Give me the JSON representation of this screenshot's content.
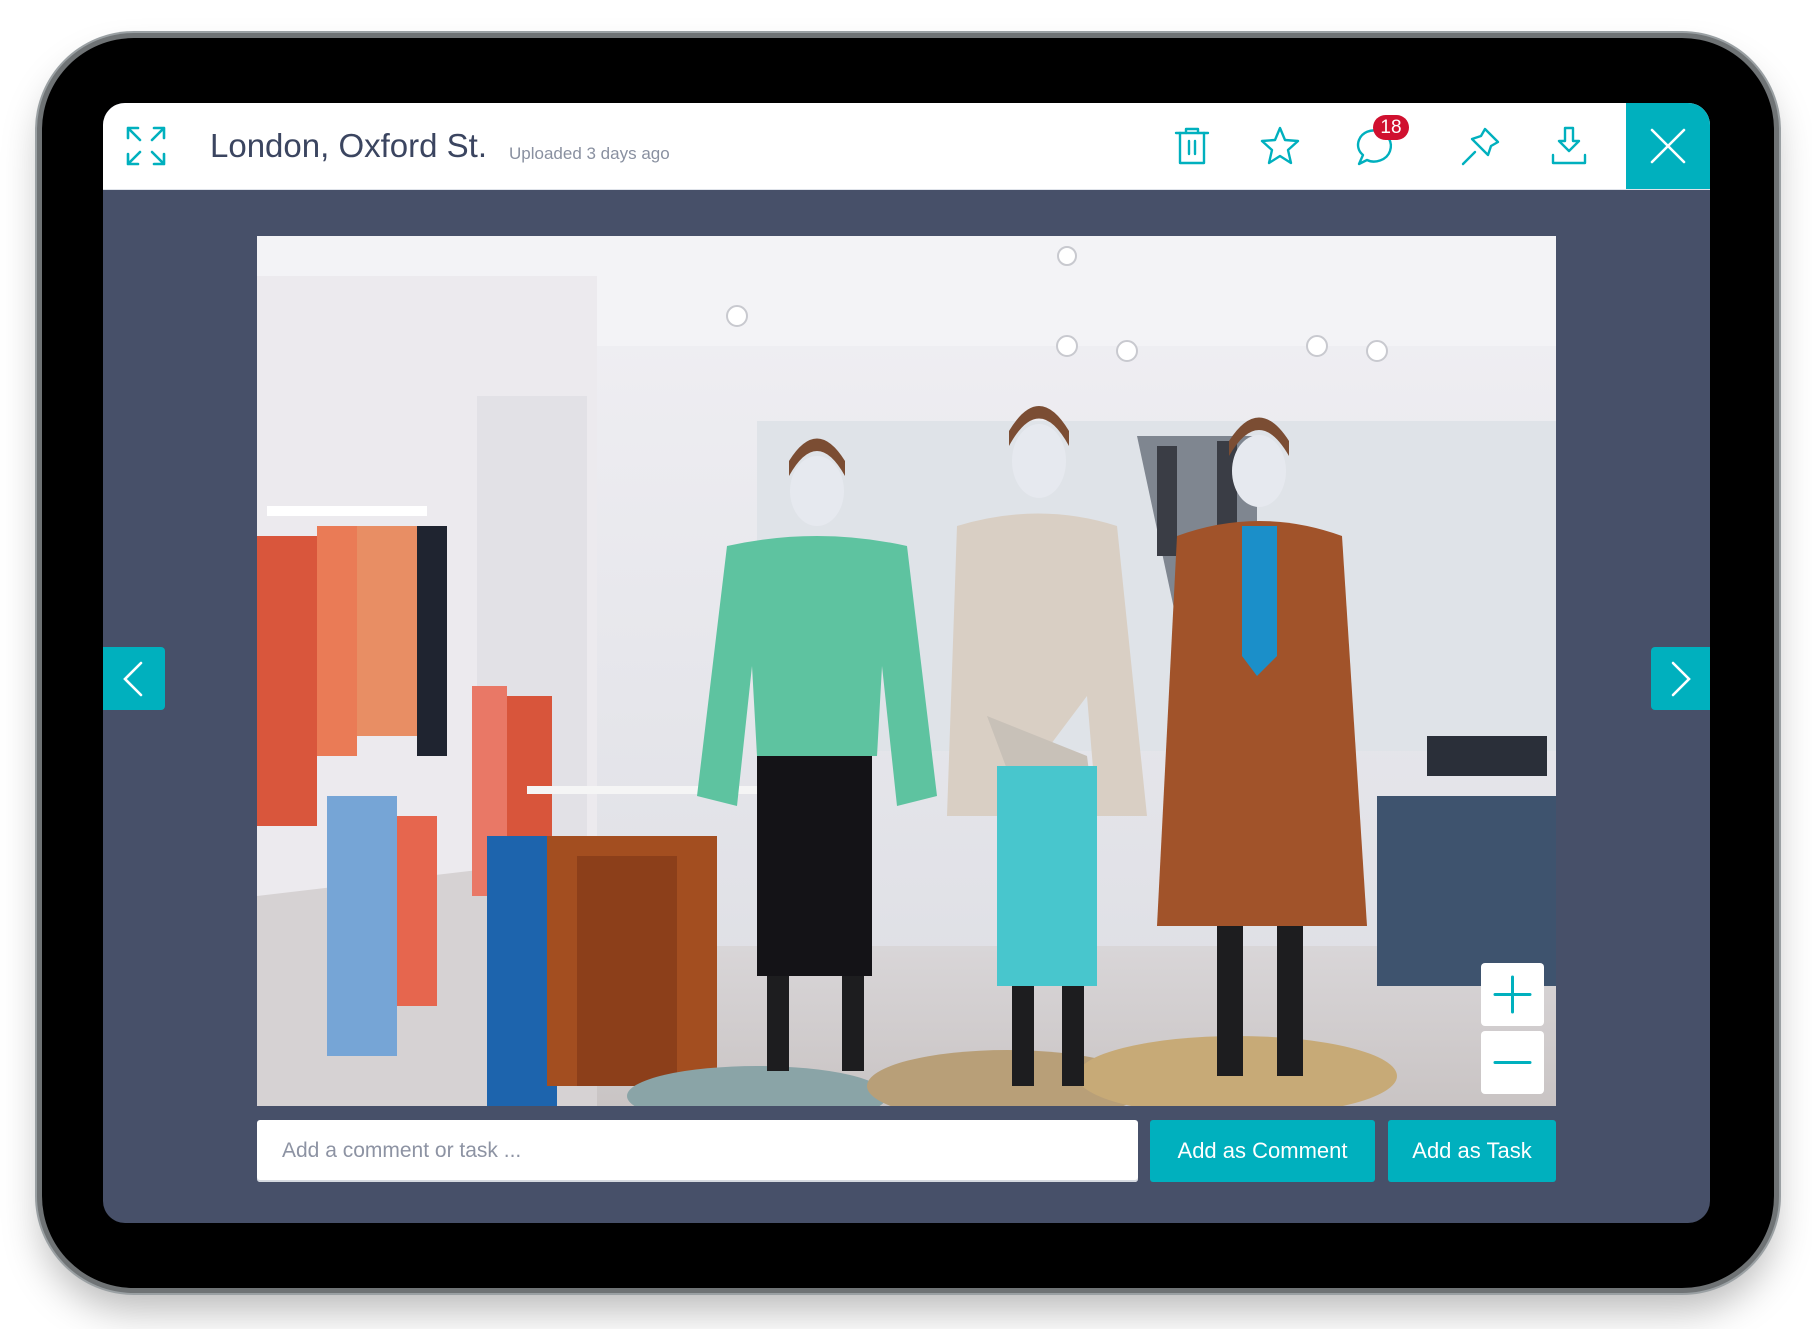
{
  "header": {
    "title": "London, Oxford St.",
    "subtitle": "Uploaded 3  days ago",
    "comment_count": "18",
    "icons": [
      "expand-icon",
      "trash-icon",
      "star-icon",
      "comment-icon",
      "pin-icon",
      "download-icon",
      "close-icon"
    ]
  },
  "navigation": {
    "prev_icon": "chevron-left-icon",
    "next_icon": "chevron-right-icon"
  },
  "photo": {
    "alt": "Three mannequins in a clothing store: green sweater with black trousers, beige corduroy jacket with teal skirt, and brown long coat; clothing racks and escalator in background"
  },
  "zoom_controls": {
    "zoom_in_icon": "plus-icon",
    "zoom_out_icon": "minus-icon"
  },
  "comment_bar": {
    "placeholder": "Add a comment or task ...",
    "value": "",
    "add_comment_label": "Add as Comment",
    "add_task_label": "Add as Task"
  },
  "colors": {
    "accent": "#00b0be",
    "badge": "#d0102f",
    "background": "#475069",
    "title_text": "#3b4560"
  }
}
